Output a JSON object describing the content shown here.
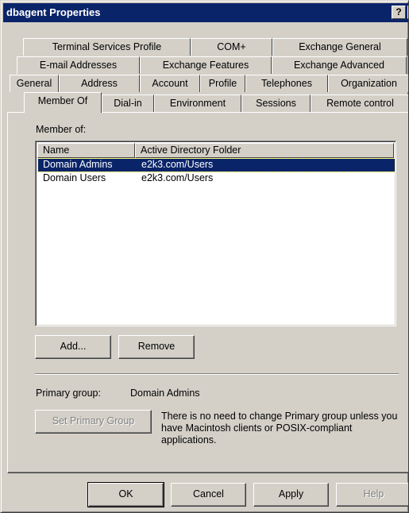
{
  "window": {
    "title": "dbagent Properties",
    "help_button": "?",
    "close_button": "✕"
  },
  "tabs": {
    "row1": [
      "Terminal Services Profile",
      "COM+",
      "Exchange General"
    ],
    "row2": [
      "E-mail Addresses",
      "Exchange Features",
      "Exchange Advanced"
    ],
    "row3": [
      "General",
      "Address",
      "Account",
      "Profile",
      "Telephones",
      "Organization"
    ],
    "row4": [
      "Member Of",
      "Dial-in",
      "Environment",
      "Sessions",
      "Remote control"
    ],
    "active": "Member Of"
  },
  "member_of": {
    "label": "Member of:",
    "columns": [
      "Name",
      "Active Directory Folder"
    ],
    "rows": [
      {
        "name": "Domain Admins",
        "folder": "e2k3.com/Users",
        "selected": true
      },
      {
        "name": "Domain Users",
        "folder": "e2k3.com/Users",
        "selected": false
      }
    ]
  },
  "actions": {
    "add": "Add...",
    "remove": "Remove"
  },
  "primary_group": {
    "label": "Primary group:",
    "value": "Domain Admins",
    "set_button": "Set Primary Group",
    "note": "There is no need to change Primary group unless you have Macintosh clients or POSIX-compliant applications."
  },
  "footer": {
    "ok": "OK",
    "cancel": "Cancel",
    "apply": "Apply",
    "help": "Help"
  },
  "colors": {
    "titlebar": "#0a246a",
    "face": "#d4d0c8",
    "selection": "#0a246a"
  }
}
